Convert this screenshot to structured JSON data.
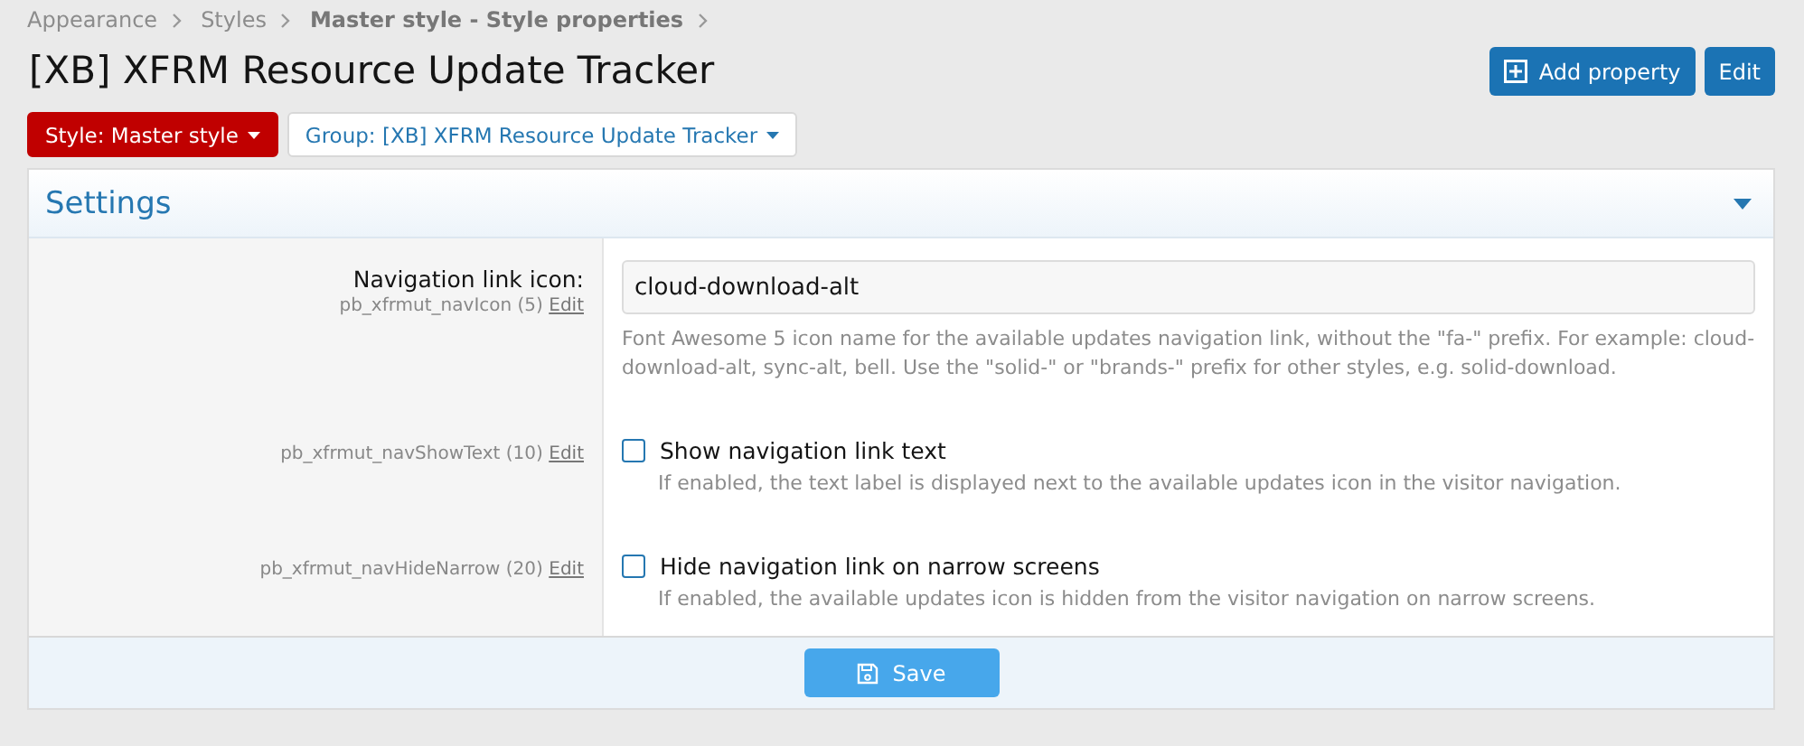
{
  "breadcrumb": [
    {
      "label": "Appearance",
      "current": false
    },
    {
      "label": "Styles",
      "current": false
    },
    {
      "label": "Master style - Style properties",
      "current": true
    }
  ],
  "title": "[XB] XFRM Resource Update Tracker",
  "actions": [
    {
      "label": "Add property",
      "kind": "add"
    },
    {
      "label": "Edit",
      "kind": "plain"
    }
  ],
  "filters": [
    {
      "label": "Style: Master style",
      "kind": "style"
    },
    {
      "label": "Group: [XB] XFRM Resource Update Tracker",
      "kind": "group"
    }
  ],
  "section": {
    "title": "Settings",
    "expanded": true
  },
  "properties": [
    {
      "kind": "text",
      "label": "Navigation link icon:",
      "name": "pb_xfrmut_navIcon (5)",
      "edit": "Edit",
      "value": "cloud-download-alt",
      "hint": "Font Awesome 5 icon name for the available updates navigation link, without the \"fa-\" prefix. For example: cloud-download-alt, sync-alt, bell. Use the \"solid-\" or \"brands-\" prefix for other styles, e.g. solid-download."
    },
    {
      "kind": "checkbox",
      "name": "pb_xfrmut_navShowText (10)",
      "edit": "Edit",
      "option": "Show navigation link text",
      "checked": false,
      "hint": "If enabled, the text label is displayed next to the available updates icon in the visitor navigation."
    },
    {
      "kind": "checkbox",
      "name": "pb_xfrmut_navHideNarrow (20)",
      "edit": "Edit",
      "option": "Hide navigation link on narrow screens",
      "checked": false,
      "hint": "If enabled, the available updates icon is hidden from the visitor navigation on narrow screens."
    }
  ],
  "save": "Save"
}
